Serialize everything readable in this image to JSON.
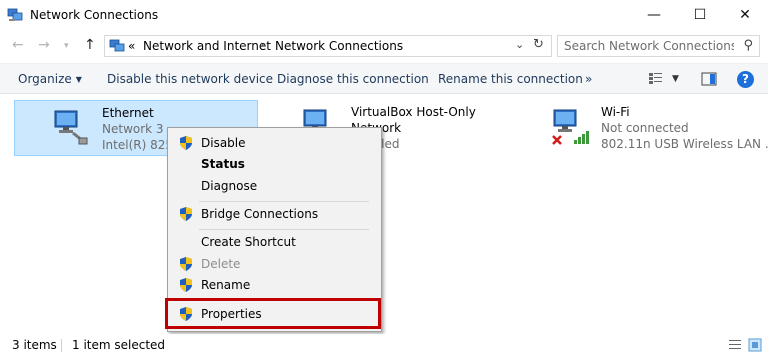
{
  "window": {
    "title": "Network Connections",
    "controls": {
      "minimize": "—",
      "maximize": "☐",
      "close": "✕"
    }
  },
  "address": {
    "prefix": "«",
    "crumbs": [
      "Network and Internet",
      "Network Connections"
    ],
    "search_placeholder": "Search Network Connections"
  },
  "toolbar": {
    "organize": "Organize",
    "disable_device": "Disable this network device",
    "diagnose": "Diagnose this connection",
    "rename": "Rename this connection",
    "more": "»",
    "help": "?"
  },
  "items": [
    {
      "name": "Ethernet",
      "line2": "Network 3",
      "line3": "Intel(R) 8257",
      "selected": true
    },
    {
      "name": "VirtualBox Host-Only",
      "line2": "Network",
      "line3": "Enabled",
      "selected": false
    },
    {
      "name": "Wi-Fi",
      "line2": "Not connected",
      "line3": "802.11n USB Wireless LAN ...",
      "selected": false
    }
  ],
  "context_menu": {
    "items": [
      {
        "label": "Disable",
        "shield": true,
        "bold": false,
        "disabled": false
      },
      {
        "label": "Status",
        "shield": false,
        "bold": true,
        "disabled": false
      },
      {
        "label": "Diagnose",
        "shield": false,
        "bold": false,
        "disabled": false
      },
      {
        "label": "Bridge Connections",
        "shield": true,
        "bold": false,
        "disabled": false
      },
      {
        "label": "Create Shortcut",
        "shield": false,
        "bold": false,
        "disabled": false
      },
      {
        "label": "Delete",
        "shield": true,
        "bold": false,
        "disabled": true
      },
      {
        "label": "Rename",
        "shield": true,
        "bold": false,
        "disabled": false
      },
      {
        "label": "Properties",
        "shield": true,
        "bold": false,
        "disabled": false,
        "highlighted": true
      }
    ]
  },
  "status": {
    "count": "3 items",
    "selection": "1 item selected"
  },
  "colors": {
    "accent": "#1e6fd9",
    "selection": "#cce8ff",
    "highlight_border": "#c00000"
  }
}
